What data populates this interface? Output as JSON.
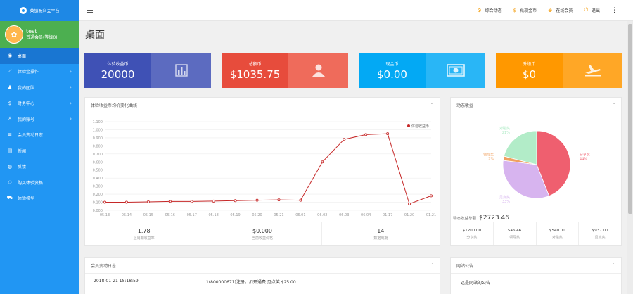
{
  "brand": {
    "title": "营销盈利云平台"
  },
  "user": {
    "name": "test",
    "level": "普通会员(等级0)"
  },
  "nav": [
    {
      "label": "桌面",
      "icon": "dashboard-icon",
      "glyph": "◉",
      "active": true,
      "arrow": false
    },
    {
      "label": "体验金操作",
      "icon": "chart-icon",
      "glyph": "⟋",
      "active": false,
      "arrow": true
    },
    {
      "label": "我的团队",
      "icon": "team-icon",
      "glyph": "♟",
      "active": false,
      "arrow": true
    },
    {
      "label": "财务中心",
      "icon": "dollar-icon",
      "glyph": "$",
      "active": false,
      "arrow": true
    },
    {
      "label": "我的账号",
      "icon": "user-icon",
      "glyph": "♙",
      "active": false,
      "arrow": true
    },
    {
      "label": "会员变动日志",
      "icon": "log-icon",
      "glyph": "≣",
      "active": false,
      "arrow": false
    },
    {
      "label": "新闻",
      "icon": "news-icon",
      "glyph": "▤",
      "active": false,
      "arrow": false
    },
    {
      "label": "反馈",
      "icon": "feedback-icon",
      "glyph": "◍",
      "active": false,
      "arrow": false
    },
    {
      "label": "购买体验资格",
      "icon": "diamond-icon",
      "glyph": "◇",
      "active": false,
      "arrow": false
    },
    {
      "label": "体验模型",
      "icon": "cart-icon",
      "glyph": "⛟",
      "active": false,
      "arrow": false
    }
  ],
  "topbar": {
    "links": [
      {
        "label": "综合动态",
        "icon": "dynamic-icon",
        "glyph": "⚙"
      },
      {
        "label": "兑现金币",
        "icon": "dollar-icon",
        "glyph": "$"
      },
      {
        "label": "在线会员",
        "icon": "members-icon",
        "glyph": "♚"
      },
      {
        "label": "退出",
        "icon": "logout-icon",
        "glyph": "⏻"
      }
    ]
  },
  "page": {
    "title": "桌面"
  },
  "stats": [
    {
      "label": "体验收益币",
      "value": "20000",
      "icon": "bar-chart-icon",
      "color_left": "#3f51b5",
      "color_right": "#5c6bc0"
    },
    {
      "label": "总额币",
      "value": "$1035.75",
      "icon": "person-icon",
      "color_left": "#e74c3c",
      "color_right": "#ef6b5b"
    },
    {
      "label": "现金币",
      "value": "$0.00",
      "icon": "money-icon",
      "color_left": "#03a9f4",
      "color_right": "#29b6f6"
    },
    {
      "label": "升级币",
      "value": "$0",
      "icon": "plane-icon",
      "color_left": "#ff9800",
      "color_right": "#ffa726"
    }
  ],
  "trend": {
    "title": "体验收益币均价变化曲线",
    "summary": [
      {
        "value": "1.78",
        "label": "上周期收益率"
      },
      {
        "value": "$0.000",
        "label": "当前收益价格"
      },
      {
        "value": "14",
        "label": "数据周期"
      }
    ]
  },
  "chart_data": [
    {
      "type": "line",
      "x": [
        "05.13",
        "05.14",
        "05.15",
        "05.16",
        "05.17",
        "05.18",
        "05.19",
        "05.20",
        "05.21",
        "06.01",
        "06.02",
        "06.03",
        "06.04",
        "01.17",
        "01.20",
        "01.21"
      ],
      "series": [
        {
          "name": "体验收益币",
          "color": "#c62828",
          "values": [
            0.1,
            0.1,
            0.105,
            0.11,
            0.11,
            0.115,
            0.12,
            0.125,
            0.13,
            0.125,
            0.6,
            0.88,
            0.94,
            0.95,
            0.08,
            0.18
          ]
        }
      ],
      "ylim": [
        0,
        1.1
      ],
      "yticks": [
        "0.000",
        "0.100",
        "0.200",
        "0.300",
        "0.400",
        "0.500",
        "0.600",
        "0.700",
        "0.800",
        "0.900",
        "1.000",
        "1.100"
      ],
      "grid": true,
      "legend": "top-right"
    },
    {
      "type": "pie",
      "title": "动态收益",
      "total_label": "动态收益总额",
      "total": "$2723.46",
      "slices": [
        {
          "label": "分享奖",
          "value": 44,
          "color": "#ef5f6f"
        },
        {
          "label": "见点奖",
          "value": 33,
          "color": "#d7b4ef"
        },
        {
          "label": "领导奖",
          "value": 2,
          "color": "#f0a060"
        },
        {
          "label": "对碰奖",
          "value": 21,
          "color": "#b2ecc8"
        }
      ],
      "slice_pct_text": [
        "44%",
        "33%",
        "2%",
        "21%"
      ]
    }
  ],
  "donut_summary": [
    {
      "value": "$1200.00",
      "label": "分享奖"
    },
    {
      "value": "$46.46",
      "label": "领导奖"
    },
    {
      "value": "$540.00",
      "label": "对碰奖"
    },
    {
      "value": "$937.00",
      "label": "见点奖"
    }
  ],
  "log_panel": {
    "title": "会员变动日志",
    "rows": [
      {
        "time": "2018-01-21 18:18:59",
        "text": "1(800000671)注册，扣开通费 见点奖 $25.00"
      }
    ]
  },
  "notice_panel": {
    "title": "网站公告",
    "rows": [
      "这是网站的公告"
    ]
  }
}
